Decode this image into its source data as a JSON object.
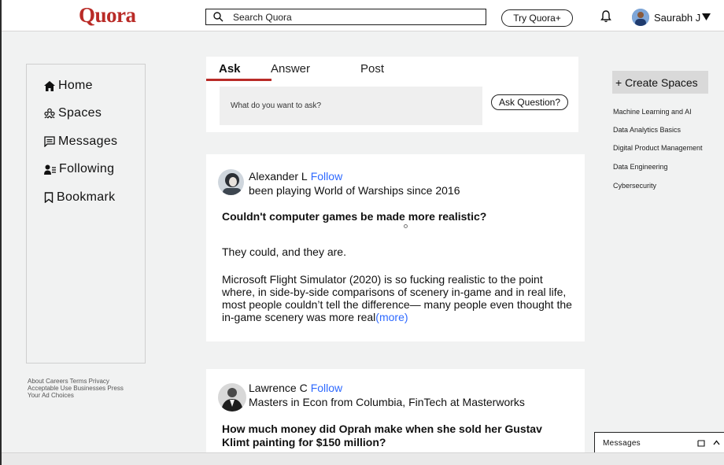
{
  "header": {
    "logo": "Quora",
    "search_placeholder": "Search Quora",
    "try_label": "Try Quora+",
    "user_name": "Saurabh J"
  },
  "nav": {
    "items": [
      {
        "label": "Home",
        "icon": "home-icon"
      },
      {
        "label": "Spaces",
        "icon": "spaces-icon"
      },
      {
        "label": "Messages",
        "icon": "messages-icon"
      },
      {
        "label": "Following",
        "icon": "following-icon"
      },
      {
        "label": "Bookmark",
        "icon": "bookmark-icon"
      }
    ]
  },
  "footer": {
    "links_line1": "About Careers Terms Privacy",
    "links_line2": "Acceptable Use Businesses Press",
    "links_line3": "Your Ad Choices"
  },
  "ask_card": {
    "tabs": [
      "Ask",
      "Answer",
      "Post"
    ],
    "placeholder": "What do you want to ask?",
    "button": "Ask Question?"
  },
  "posts": [
    {
      "author": "Alexander L",
      "follow": "Follow",
      "credential": "been playing World of Warships since 2016",
      "question": "Couldn't computer games be made more realistic?",
      "answer_p1": "They could, and they are.",
      "answer_p2": "Microsoft Flight Simulator (2020) is so fucking realistic to the point where, in side-by-side comparisons of scenery in-game and in real life, most people couldn’t tell the difference— many people even thought the in-game scenery  was more real",
      "more": "(more)"
    },
    {
      "author": "Lawrence C",
      "follow": "Follow",
      "credential": "Masters in Econ from Columbia, FinTech at Masterworks",
      "question_line1": "How much money did Oprah make when she sold her Gustav",
      "question_line2": "Klimt painting for $150 million?"
    }
  ],
  "right": {
    "create_label": "+ Create Spaces",
    "spaces": [
      "Machine Learning and AI",
      "Data Analytics Basics",
      "Digital Product Management",
      "Data Engineering",
      "Cybersecurity"
    ]
  },
  "messages_bar": {
    "label": "Messages"
  },
  "colors": {
    "brand": "#b92b27",
    "link": "#2e69ff"
  }
}
